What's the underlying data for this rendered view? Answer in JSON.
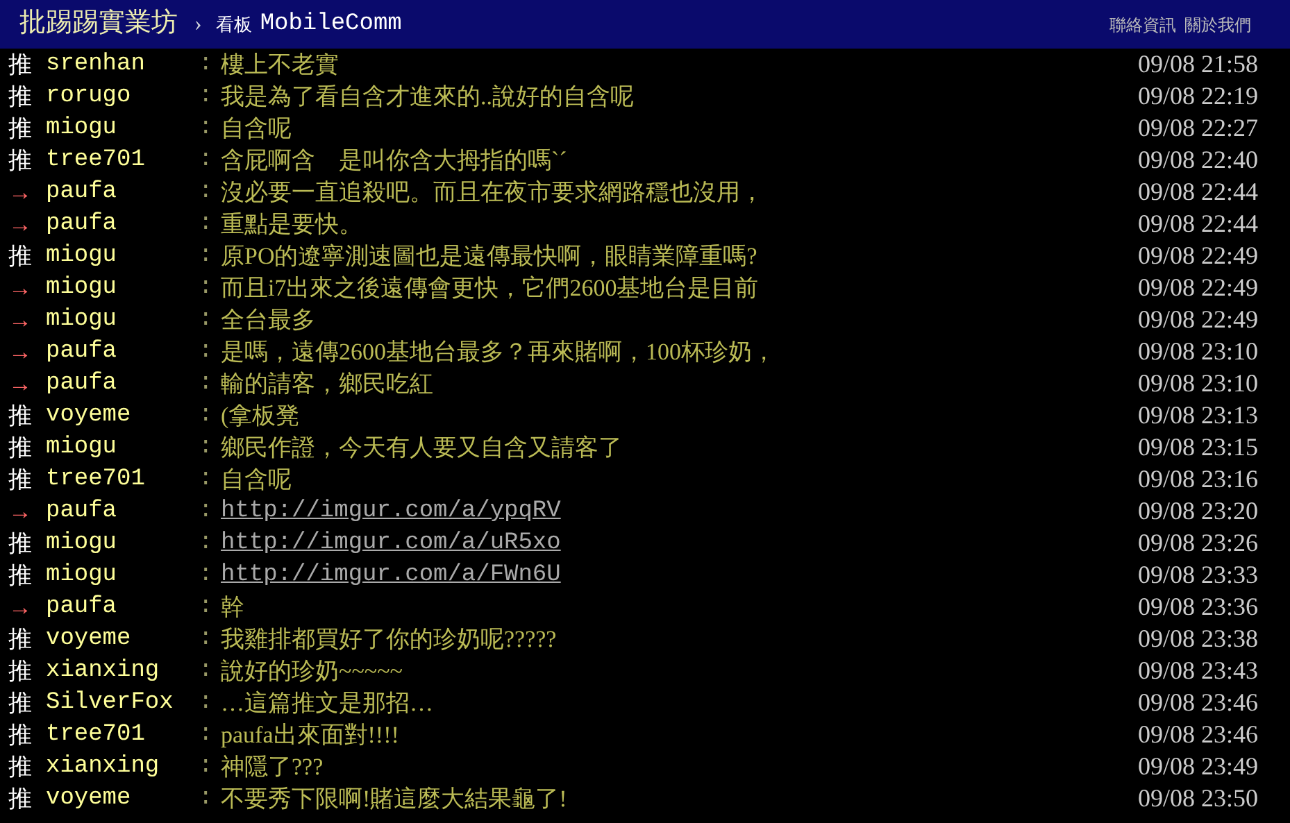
{
  "header": {
    "site": "批踢踢實業坊",
    "separator": "›",
    "board_label": "看板",
    "board": "MobileComm",
    "links": [
      "聯絡資訊",
      "關於我們"
    ]
  },
  "pushes": [
    {
      "kind": "push",
      "tag": "推",
      "user": "srenhan",
      "colon": ":",
      "content": "樓上不老實",
      "link": false,
      "time": "09/08 21:58"
    },
    {
      "kind": "push",
      "tag": "推",
      "user": "rorugo",
      "colon": ":",
      "content": "我是為了看自含才進來的..說好的自含呢",
      "link": false,
      "time": "09/08 22:19"
    },
    {
      "kind": "push",
      "tag": "推",
      "user": "miogu",
      "colon": ":",
      "content": "自含呢",
      "link": false,
      "time": "09/08 22:27"
    },
    {
      "kind": "push",
      "tag": "推",
      "user": "tree701",
      "colon": ":",
      "content": "含屁啊含　是叫你含大拇指的嗎ˋˊ",
      "link": false,
      "time": "09/08 22:40"
    },
    {
      "kind": "arrow",
      "tag": "→",
      "user": "paufa",
      "colon": ":",
      "content": "沒必要一直追殺吧。而且在夜市要求網路穩也沒用，",
      "link": false,
      "time": "09/08 22:44"
    },
    {
      "kind": "arrow",
      "tag": "→",
      "user": "paufa",
      "colon": ":",
      "content": "重點是要快。",
      "link": false,
      "time": "09/08 22:44"
    },
    {
      "kind": "push",
      "tag": "推",
      "user": "miogu",
      "colon": ":",
      "content": "原PO的遼寧測速圖也是遠傳最快啊，眼睛業障重嗎?",
      "link": false,
      "time": "09/08 22:49"
    },
    {
      "kind": "arrow",
      "tag": "→",
      "user": "miogu",
      "colon": ":",
      "content": "而且i7出來之後遠傳會更快，它們2600基地台是目前",
      "link": false,
      "time": "09/08 22:49"
    },
    {
      "kind": "arrow",
      "tag": "→",
      "user": "miogu",
      "colon": ":",
      "content": "全台最多",
      "link": false,
      "time": "09/08 22:49"
    },
    {
      "kind": "arrow",
      "tag": "→",
      "user": "paufa",
      "colon": ":",
      "content": "是嗎，遠傳2600基地台最多？再來賭啊，100杯珍奶，",
      "link": false,
      "time": "09/08 23:10"
    },
    {
      "kind": "arrow",
      "tag": "→",
      "user": "paufa",
      "colon": ":",
      "content": "輸的請客，鄉民吃紅",
      "link": false,
      "time": "09/08 23:10"
    },
    {
      "kind": "push",
      "tag": "推",
      "user": "voyeme",
      "colon": ":",
      "content": "(拿板凳",
      "link": false,
      "time": "09/08 23:13"
    },
    {
      "kind": "push",
      "tag": "推",
      "user": "miogu",
      "colon": ":",
      "content": "鄉民作證，今天有人要又自含又請客了",
      "link": false,
      "time": "09/08 23:15"
    },
    {
      "kind": "push",
      "tag": "推",
      "user": "tree701",
      "colon": ":",
      "content": "自含呢",
      "link": false,
      "time": "09/08 23:16"
    },
    {
      "kind": "arrow",
      "tag": "→",
      "user": "paufa",
      "colon": ":",
      "content": "http://imgur.com/a/ypqRV",
      "link": true,
      "time": "09/08 23:20"
    },
    {
      "kind": "push",
      "tag": "推",
      "user": "miogu",
      "colon": ":",
      "content": "http://imgur.com/a/uR5xo",
      "link": true,
      "time": "09/08 23:26"
    },
    {
      "kind": "push",
      "tag": "推",
      "user": "miogu",
      "colon": ":",
      "content": "http://imgur.com/a/FWn6U",
      "link": true,
      "time": "09/08 23:33"
    },
    {
      "kind": "arrow",
      "tag": "→",
      "user": "paufa",
      "colon": ":",
      "content": "幹",
      "link": false,
      "time": "09/08 23:36"
    },
    {
      "kind": "push",
      "tag": "推",
      "user": "voyeme",
      "colon": ":",
      "content": "我雞排都買好了你的珍奶呢?????",
      "link": false,
      "time": "09/08 23:38"
    },
    {
      "kind": "push",
      "tag": "推",
      "user": "xianxing",
      "colon": ":",
      "content": "說好的珍奶~~~~~",
      "link": false,
      "time": "09/08 23:43"
    },
    {
      "kind": "push",
      "tag": "推",
      "user": "SilverFox",
      "colon": ":",
      "content": "…這篇推文是那招…",
      "link": false,
      "time": "09/08 23:46"
    },
    {
      "kind": "push",
      "tag": "推",
      "user": "tree701",
      "colon": ":",
      "content": "paufa出來面對!!!!",
      "link": false,
      "time": "09/08 23:46"
    },
    {
      "kind": "push",
      "tag": "推",
      "user": "xianxing",
      "colon": ":",
      "content": "神隱了???",
      "link": false,
      "time": "09/08 23:49"
    },
    {
      "kind": "push",
      "tag": "推",
      "user": "voyeme",
      "colon": ":",
      "content": "不要秀下限啊!賭這麼大結果龜了!",
      "link": false,
      "time": "09/08 23:50"
    }
  ]
}
